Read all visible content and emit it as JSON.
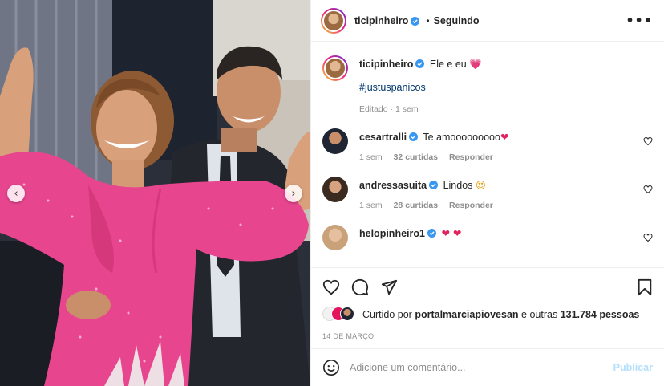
{
  "post": {
    "author": "ticipinheiro",
    "separator": "•",
    "follow_status": "Seguindo",
    "more_label": "•••",
    "caption_text": "Ele e eu",
    "caption_emoji": "💗",
    "hashtag": "#justuspanicos",
    "caption_edited": "Editado",
    "caption_time": "1 sem"
  },
  "comments": [
    {
      "user": "cesartralli",
      "text": "Te amooooooooo",
      "emoji": "❤",
      "time": "1 sem",
      "likes": "32 curtidas",
      "reply": "Responder"
    },
    {
      "user": "andressasuita",
      "text": "Lindos",
      "emoji": "😍",
      "time": "1 sem",
      "likes": "28 curtidas",
      "reply": "Responder"
    },
    {
      "user": "helopinheiro1",
      "text": "",
      "emoji": "❤ ❤",
      "time": "",
      "likes": "",
      "reply": ""
    }
  ],
  "likes": {
    "prefix": "Curtido por",
    "user": "portalmarciapiovesan",
    "connector": "e outras",
    "count": "131.784 pessoas"
  },
  "date": "14 DE MARÇO",
  "add_comment": {
    "placeholder": "Adicione um comentário...",
    "publish_label": "Publicar"
  },
  "carousel": {
    "prev_icon": "‹",
    "next_icon": "›"
  },
  "colors": {
    "verified": "#3897f0",
    "heart": "#ed4956",
    "dress": "#e8458f",
    "link": "#00376b"
  }
}
